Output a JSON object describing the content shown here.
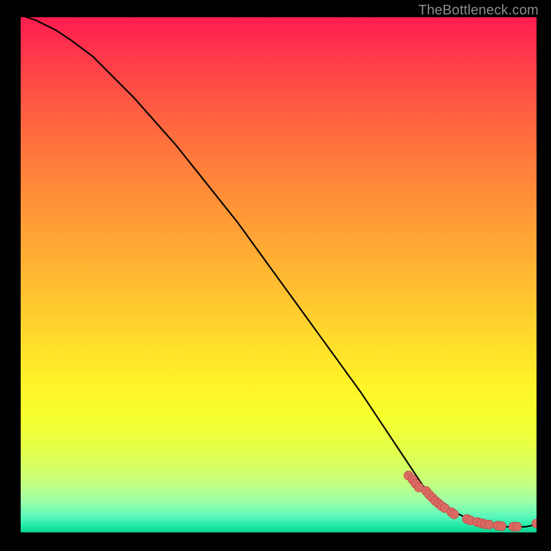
{
  "watermark": "TheBottleneck.com",
  "colors": {
    "dot_fill": "#d96a63",
    "dot_stroke": "#c74f48",
    "curve": "#000000",
    "background": "#000000"
  },
  "chart_data": {
    "type": "line",
    "title": "",
    "xlabel": "",
    "ylabel": "",
    "xlim": [
      0,
      100
    ],
    "ylim": [
      0,
      100
    ],
    "grid": false,
    "legend": null,
    "series": [
      {
        "name": "curve",
        "type": "line",
        "x": [
          0,
          3,
          7,
          10,
          14,
          18,
          22,
          26,
          30,
          34,
          38,
          42,
          46,
          50,
          54,
          58,
          62,
          66,
          70,
          74,
          78,
          80,
          82,
          84,
          86,
          88,
          90,
          92,
          94,
          96,
          98,
          100
        ],
        "y": [
          100,
          99,
          97,
          95,
          92,
          88,
          84,
          79.5,
          75,
          70,
          65,
          60,
          54.5,
          49,
          43.5,
          38,
          32.5,
          27,
          21,
          15,
          9,
          7,
          5.5,
          4,
          3,
          2.3,
          1.7,
          1.3,
          1.1,
          1,
          1.1,
          1.5
        ]
      },
      {
        "name": "points",
        "type": "scatter",
        "x": [
          75.2,
          76.0,
          76.6,
          77.2,
          78.6,
          79.2,
          79.8,
          80.4,
          81.0,
          81.6,
          82.2,
          83.5,
          84.0,
          86.5,
          87.2,
          88.5,
          89.3,
          90.0,
          90.8,
          92.5,
          93.2,
          95.5,
          96.2,
          100.0
        ],
        "y": [
          11.0,
          10.2,
          9.4,
          8.7,
          8.0,
          7.3,
          6.7,
          6.1,
          5.6,
          5.1,
          4.7,
          3.9,
          3.5,
          2.6,
          2.3,
          2.0,
          1.8,
          1.6,
          1.5,
          1.3,
          1.2,
          1.1,
          1.1,
          1.7
        ]
      }
    ]
  }
}
